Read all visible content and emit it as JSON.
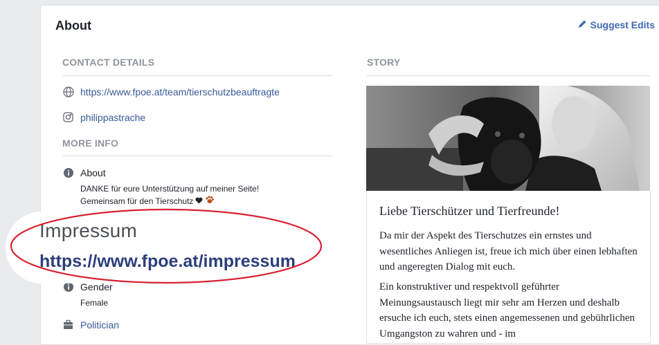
{
  "about_card": {
    "title": "About",
    "suggest_edits": "Suggest Edits"
  },
  "contact": {
    "heading": "CONTACT DETAILS",
    "website": "https://www.fpoe.at/team/tierschutzbeauftragte",
    "instagram": "philippastrache"
  },
  "more_info": {
    "heading": "MORE INFO",
    "about_label": "About",
    "about_line1": "DANKE für eure Unterstützung auf meiner Seite!",
    "about_line2": "Gemeinsam für den Tierschutz",
    "gender_label": "Gender",
    "gender_value": "Female",
    "category": "Politician"
  },
  "callout": {
    "title": "Impressum",
    "link": "https://www.fpoe.at/impressum",
    "ellipse_color": "#d9202f"
  },
  "story": {
    "heading": "STORY",
    "title": "Liebe Tierschützer und Tierfreunde!",
    "para1": "Da mir der Aspekt des Tierschutzes ein ernstes und wesentliches Anliegen ist, freue ich mich über einen lebhaften und angeregten Dialog mit euch.",
    "para2": "Ein konstruktiver und respektvoll geführter Meinungsaustausch liegt mir sehr am Herzen und deshalb ersuche ich euch, stets einen angemessenen und gebührlichen Umgangston zu wahren und - im"
  },
  "icons": [
    "pencil-icon",
    "globe-icon",
    "instagram-icon",
    "info-icon",
    "briefcase-icon",
    "heart-icon",
    "paw-icon"
  ],
  "colors": {
    "link": "#365899",
    "accent": "#4267b2",
    "muted": "#90949c"
  }
}
